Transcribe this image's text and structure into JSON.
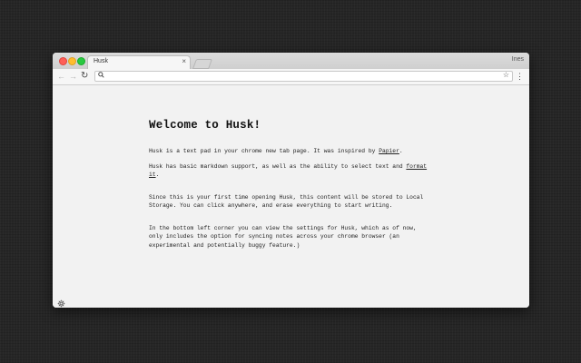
{
  "browser": {
    "tab_title": "Husk",
    "tab_close": "×",
    "profile_name": "Ines",
    "url": ""
  },
  "icons": {
    "back": "back-arrow-icon",
    "forward": "forward-arrow-icon",
    "reload": "reload-icon",
    "search": "search-icon",
    "star": "star-icon",
    "menu": "kebab-menu-icon",
    "settings": "gear-icon"
  },
  "glyphs": {
    "back": "←",
    "forward": "→",
    "reload": "↻",
    "search": "⚲",
    "star": "☆",
    "menu": "⋮"
  },
  "page": {
    "heading": "Welcome to Husk!",
    "p1_text": "Husk is a text pad in your chrome new tab page. It was inspired by ",
    "p1_link": "Papier",
    "p1_end": ".",
    "p2_text": "Husk has basic markdown support, as well as the ability to select text and ",
    "p2_link": "format it",
    "p2_end": ".",
    "p3": "Since this is your first time opening Husk, this content will be stored to Local Storage. You can click anywhere, and erase everything to start writing.",
    "p4": "In the bottom left corner you can view the settings for Husk, which as of now, only includes the option for syncing notes across your chrome browser (an experimental and potentially buggy feature.)"
  },
  "colors": {
    "desktop_bg": "#262626",
    "page_bg": "#f2f2f2",
    "close_red": "#ff5f57",
    "minimize_yellow": "#ffbd2e",
    "maximize_green": "#28c940"
  }
}
